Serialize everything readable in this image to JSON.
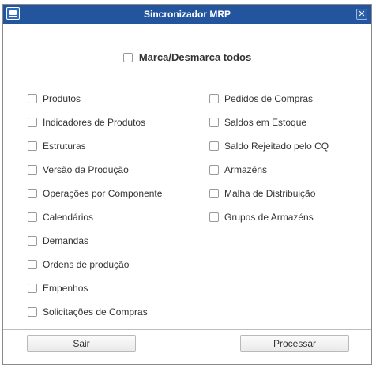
{
  "window": {
    "title": "Sincronizador MRP"
  },
  "check_all": {
    "label": "Marca/Desmarca todos",
    "checked": false
  },
  "left_options": [
    {
      "label": "Produtos",
      "checked": false
    },
    {
      "label": "Indicadores de Produtos",
      "checked": false
    },
    {
      "label": "Estruturas",
      "checked": false
    },
    {
      "label": "Versão da Produção",
      "checked": false
    },
    {
      "label": "Operações por Componente",
      "checked": false
    },
    {
      "label": "Calendários",
      "checked": false
    },
    {
      "label": "Demandas",
      "checked": false
    },
    {
      "label": "Ordens de produção",
      "checked": false
    },
    {
      "label": "Empenhos",
      "checked": false
    },
    {
      "label": "Solicitações de Compras",
      "checked": false
    }
  ],
  "right_options": [
    {
      "label": "Pedidos de Compras",
      "checked": false
    },
    {
      "label": "Saldos em Estoque",
      "checked": false
    },
    {
      "label": "Saldo Rejeitado pelo CQ",
      "checked": false
    },
    {
      "label": "Armazéns",
      "checked": false
    },
    {
      "label": "Malha de Distribuição",
      "checked": false
    },
    {
      "label": "Grupos de Armazéns",
      "checked": false
    }
  ],
  "footer": {
    "exit_label": "Sair",
    "process_label": "Processar"
  }
}
